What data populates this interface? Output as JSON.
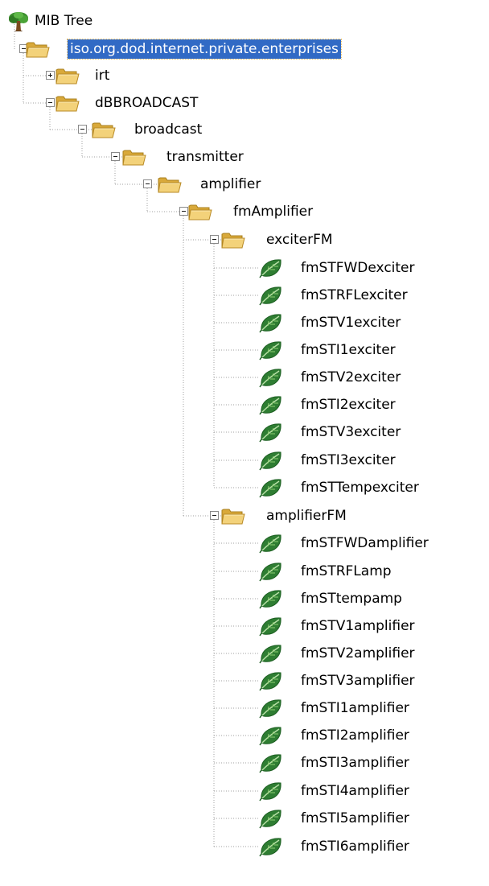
{
  "tree": {
    "root": {
      "label": "MIB Tree",
      "icon": "tree-icon"
    },
    "selected_node": "iso.org.dod.internet.private.enterprises",
    "colors": {
      "selection": "#316ac5",
      "folder": "#f3d27a",
      "leaf": "#2e7d32",
      "connector": "#a0a0a0"
    },
    "nodes": [
      {
        "label": "iso.org.dod.internet.private.enterprises",
        "type": "folder",
        "state": "expanded",
        "selected": true
      },
      {
        "label": "irt",
        "type": "folder",
        "state": "collapsed"
      },
      {
        "label": "dBBROADCAST",
        "type": "folder",
        "state": "expanded"
      },
      {
        "label": "broadcast",
        "type": "folder",
        "state": "expanded"
      },
      {
        "label": "transmitter",
        "type": "folder",
        "state": "expanded"
      },
      {
        "label": "amplifier",
        "type": "folder",
        "state": "expanded"
      },
      {
        "label": "fmAmplifier",
        "type": "folder",
        "state": "expanded"
      },
      {
        "label": "exciterFM",
        "type": "folder",
        "state": "expanded"
      },
      {
        "label": "fmSTFWDexciter",
        "type": "leaf"
      },
      {
        "label": "fmSTRFLexciter",
        "type": "leaf"
      },
      {
        "label": "fmSTV1exciter",
        "type": "leaf"
      },
      {
        "label": "fmSTI1exciter",
        "type": "leaf"
      },
      {
        "label": "fmSTV2exciter",
        "type": "leaf"
      },
      {
        "label": "fmSTI2exciter",
        "type": "leaf"
      },
      {
        "label": "fmSTV3exciter",
        "type": "leaf"
      },
      {
        "label": "fmSTI3exciter",
        "type": "leaf"
      },
      {
        "label": "fmSTTempexciter",
        "type": "leaf"
      },
      {
        "label": "amplifierFM",
        "type": "folder",
        "state": "expanded"
      },
      {
        "label": "fmSTFWDamplifier",
        "type": "leaf"
      },
      {
        "label": "fmSTRFLamp",
        "type": "leaf"
      },
      {
        "label": "fmSTtempamp",
        "type": "leaf"
      },
      {
        "label": "fmSTV1amplifier",
        "type": "leaf"
      },
      {
        "label": "fmSTV2amplifier",
        "type": "leaf"
      },
      {
        "label": "fmSTV3amplifier",
        "type": "leaf"
      },
      {
        "label": "fmSTI1amplifier",
        "type": "leaf"
      },
      {
        "label": "fmSTI2amplifier",
        "type": "leaf"
      },
      {
        "label": "fmSTI3amplifier",
        "type": "leaf"
      },
      {
        "label": "fmSTI4amplifier",
        "type": "leaf"
      },
      {
        "label": "fmSTI5amplifier",
        "type": "leaf"
      },
      {
        "label": "fmSTI6amplifier",
        "type": "leaf"
      }
    ]
  }
}
